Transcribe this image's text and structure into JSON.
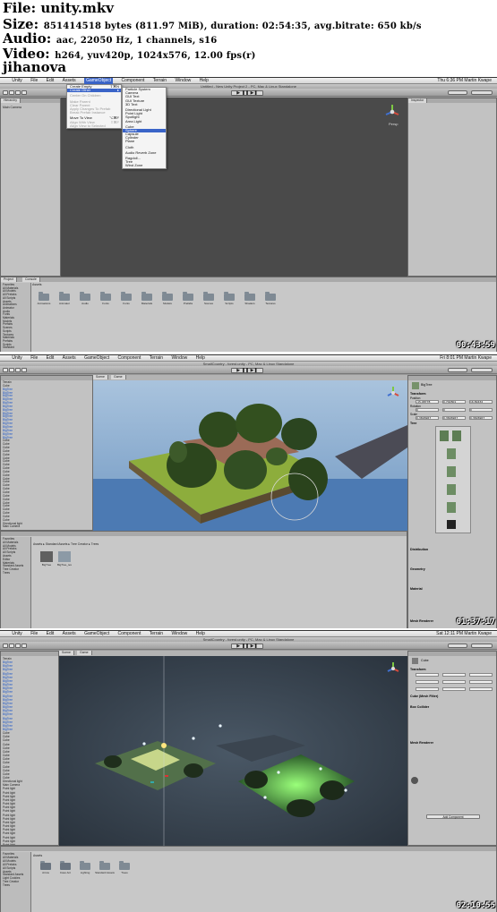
{
  "header": {
    "file": "File: unity.mkv",
    "size_label": "Size:",
    "size_value": "851414518 bytes (811.97 MiB), duration: 02:54:35, avg.bitrate: 650 kb/s",
    "audio_label": "Audio:",
    "audio_value": "aac, 22050 Hz, 1 channels, s16",
    "video_label": "Video:",
    "video_value": "h264, yuv420p, 1024x576, 12.00 fps(r)",
    "author": "jihanova"
  },
  "colors": {
    "unity_bg": "#c2c2c2",
    "toolbar": "#a6a6a6",
    "highlight": "#3a64c8",
    "viewport_grey": "#4a4a4a"
  },
  "frames": [
    {
      "timestamp": "00:43:59",
      "menubar": [
        "Unity",
        "File",
        "Edit",
        "Assets",
        "GameObject",
        "Component",
        "Terrain",
        "Window",
        "Help"
      ],
      "active_menu": "GameObject",
      "menubar_right": "Thu 6:36 PM   Martin Kwape",
      "window_title": "Untitled - New Unity Project 2 - PC, Mac & Linux Standalone",
      "gameobject_menu": [
        {
          "label": "Create Empty",
          "shortcut": "⇧⌘N",
          "state": "normal"
        },
        {
          "label": "Create Other",
          "shortcut": "▸",
          "state": "highlight"
        },
        {
          "label": "Center On Children",
          "state": "dim"
        },
        {
          "label": "Make Parent",
          "state": "dim"
        },
        {
          "label": "Clear Parent",
          "state": "dim"
        },
        {
          "label": "Apply Changes To Prefab",
          "state": "dim"
        },
        {
          "label": "Break Prefab Instance",
          "state": "dim"
        },
        {
          "label": "Move To View",
          "shortcut": "⌥⌘F",
          "state": "normal"
        },
        {
          "label": "Align With View",
          "shortcut": "⇧⌘F",
          "state": "dim"
        },
        {
          "label": "Align View to Selected",
          "state": "dim"
        }
      ],
      "create_other_menu": [
        "Particle System",
        "Camera",
        "GUI Text",
        "GUI Texture",
        "3D Text",
        "",
        "Directional Light",
        "Point Light",
        "Spotlight",
        "Area Light",
        "",
        "Cube",
        "Sphere",
        "Capsule",
        "Cylinder",
        "Plane",
        "",
        "Cloth",
        "",
        "Audio Reverb Zone",
        "",
        "Ragdoll...",
        "Tree",
        "Wind Zone"
      ],
      "create_other_selected": "Sphere",
      "hierarchy_title": "Hierarchy",
      "hierarchy_items": [
        "Main Camera"
      ],
      "inspector_title": "Inspector",
      "project_title": "Project",
      "console_title": "Console",
      "project_tree": [
        "Favorites",
        "All Materials",
        "All Models",
        "All Prefabs",
        "All Scripts",
        "Assets",
        "Animations",
        "Animator",
        "Audio",
        "Fonts",
        "Materials",
        "Models",
        "Prefabs",
        "Scenes",
        "Scripts",
        "Textures",
        "Materials",
        "Prefabs",
        "Scripts",
        "Standard"
      ],
      "assets_label": "Assets",
      "folders": [
        "Animations",
        "Animator",
        "Audio",
        "Fonts",
        "Fonts",
        "Materials",
        "Models",
        "Prefabs",
        "Scenes",
        "Scripts",
        "Shaders",
        "Textures"
      ],
      "gizmo_label": "Persp"
    },
    {
      "timestamp": "01:37:17",
      "menubar": [
        "Unity",
        "File",
        "Edit",
        "Assets",
        "GameObject",
        "Component",
        "Terrain",
        "Window",
        "Help"
      ],
      "menubar_right": "Fri 8:01 PM   Martin Kwape",
      "window_title": "SmallCountry - forest.unity - PC, Mac & Linux Standalone",
      "scene_tab": "Scene",
      "game_tab": "Game",
      "hierarchy_items": [
        "Terrain",
        "Cube",
        "BigTree",
        "BigTree",
        "BigTree",
        "BigTree",
        "BigTree",
        "BigTree",
        "BigTree",
        "BigTree",
        "BigTree",
        "BigTree",
        "BigTree",
        "BigTree",
        "BigTree",
        "BigTree",
        "BigTree",
        "Cube",
        "Cube",
        "Cube",
        "Cube",
        "Cube",
        "Cube",
        "Cube",
        "Cube",
        "Cube",
        "Cube",
        "Cube",
        "Cube",
        "Cube",
        "Cube",
        "Cube",
        "Cube",
        "Cube",
        "Cube",
        "Cube",
        "Cube",
        "Cube",
        "Cube",
        "Cube",
        "Cube",
        "Directional light",
        "Main Camera"
      ],
      "inspector_name": "BigTree",
      "inspector_sections": [
        "Transform",
        "Position",
        "Rotation",
        "Scale",
        "Tree",
        "Distribution",
        "Geometry",
        "Material",
        "Mesh Renderer"
      ],
      "transform_values": {
        "pos": [
          "-15.98778",
          "0.702801",
          "16.89432"
        ],
        "rot": [
          "0",
          "0",
          "0"
        ],
        "scale": [
          "0.3696967",
          "0.3696967",
          "0.3696967"
        ]
      },
      "project_breadcrumb": [
        "Assets",
        "Standard Assets",
        "Tree Creator",
        "Trees"
      ],
      "assets_items": [
        "BigTree",
        "BigTree_tex"
      ],
      "project_tree": [
        "Favorites",
        "All Materials",
        "All Models",
        "All Prefabs",
        "All Scripts",
        "Assets",
        "Editor",
        "Materials",
        "Standard Assets",
        "Tree Creator",
        "Trees"
      ]
    },
    {
      "timestamp": "02:10:55",
      "menubar": [
        "Unity",
        "File",
        "Edit",
        "Assets",
        "GameObject",
        "Component",
        "Terrain",
        "Window",
        "Help"
      ],
      "menubar_right": "Sat 12:11 PM   Martin Kwape",
      "window_title": "SmallCountry - forest.unity - PC, Mac & Linux Standalone",
      "scene_tab": "Scene",
      "game_tab": "Game",
      "hierarchy_items": [
        "Terrain",
        "BigTree",
        "BigTree",
        "BigTree",
        "BigTree",
        "BigTree",
        "BigTree",
        "BigTree",
        "BigTree",
        "BigTree",
        "BigTree",
        "BigTree",
        "BigTree",
        "BigTree",
        "BigTree",
        "BigTree",
        "BigTree",
        "BigTree",
        "BigTree",
        "BigTree",
        "Cube",
        "Cube",
        "Cube",
        "Cube",
        "Cube",
        "Cube",
        "Cube",
        "Cube",
        "Cube",
        "Cube",
        "Cube",
        "Cube",
        "Cube",
        "Directional light",
        "Main Camera",
        "Point light",
        "Point light",
        "Point light",
        "Point light",
        "Point light",
        "Point light",
        "Point light",
        "Point light",
        "Point light",
        "Point light",
        "Point light",
        "Point light",
        "Point light",
        "Point light",
        "Point light",
        "Point light"
      ],
      "inspector_name": "Cube",
      "inspector_sections": [
        "Transform",
        "Cube (Mesh Filter)",
        "Box Collider",
        "Mesh Renderer"
      ],
      "add_component": "Add Component",
      "project_breadcrumb": [
        "Assets"
      ],
      "assets_items": [
        "Arrow",
        "Cave Arc",
        "Lighting",
        "Standard Assets",
        "Trees"
      ],
      "project_tree": [
        "Favorites",
        "All Materials",
        "All Models",
        "All Prefabs",
        "All Scripts",
        "Assets",
        "Standard Assets",
        "Light Cookies",
        "Tree Creator",
        "Trees"
      ]
    }
  ]
}
